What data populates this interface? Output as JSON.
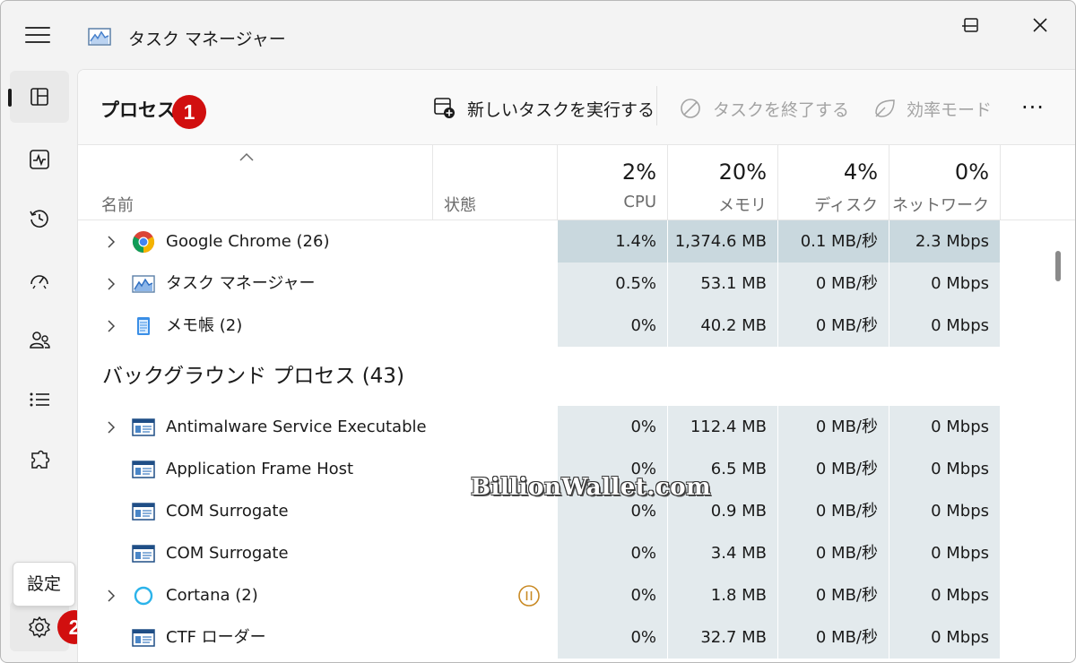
{
  "app": {
    "title": "タスク マネージャー"
  },
  "toolbar": {
    "page_title": "プロセス",
    "new_task_label": "新しいタスクを実行する",
    "end_task_label": "タスクを終了する",
    "efficiency_label": "効率モード",
    "more_label": "..."
  },
  "badges": {
    "one": "1",
    "two": "2"
  },
  "sidebar": {
    "tooltip_label": "設定"
  },
  "columns": {
    "name": "名前",
    "status": "状態",
    "cpu": {
      "pct": "2%",
      "label": "CPU"
    },
    "memory": {
      "pct": "20%",
      "label": "メモリ"
    },
    "disk": {
      "pct": "4%",
      "label": "ディスク"
    },
    "network": {
      "pct": "0%",
      "label": "ネットワーク"
    }
  },
  "apps_rows": [
    {
      "name": "Google Chrome (26)",
      "icon": "chrome-icon",
      "cpu": "1.4%",
      "memory": "1,374.6 MB",
      "disk": "0.1 MB/秒",
      "network": "2.3 Mbps"
    },
    {
      "name": "タスク マネージャー",
      "icon": "task-manager-icon",
      "cpu": "0.5%",
      "memory": "53.1 MB",
      "disk": "0 MB/秒",
      "network": "0 Mbps"
    },
    {
      "name": "メモ帳 (2)",
      "icon": "notepad-icon",
      "cpu": "0%",
      "memory": "40.2 MB",
      "disk": "0 MB/秒",
      "network": "0 Mbps"
    }
  ],
  "background_group": {
    "title": "バックグラウンド プロセス (43)"
  },
  "background_rows": [
    {
      "name": "Antimalware Service Executable",
      "icon": "window-icon",
      "cpu": "0%",
      "memory": "112.4 MB",
      "disk": "0 MB/秒",
      "network": "0 Mbps"
    },
    {
      "name": "Application Frame Host",
      "icon": "window-icon",
      "cpu": "0%",
      "memory": "6.5 MB",
      "disk": "0 MB/秒",
      "network": "0 Mbps"
    },
    {
      "name": "COM Surrogate",
      "icon": "window-icon",
      "cpu": "0%",
      "memory": "0.9 MB",
      "disk": "0 MB/秒",
      "network": "0 Mbps"
    },
    {
      "name": "COM Surrogate",
      "icon": "window-icon",
      "cpu": "0%",
      "memory": "3.4 MB",
      "disk": "0 MB/秒",
      "network": "0 Mbps"
    },
    {
      "name": "Cortana (2)",
      "icon": "cortana-icon",
      "cpu": "0%",
      "memory": "1.8 MB",
      "disk": "0 MB/秒",
      "network": "0 Mbps"
    },
    {
      "name": "CTF ローダー",
      "icon": "window-icon",
      "cpu": "0%",
      "memory": "32.7 MB",
      "disk": "0 MB/秒",
      "network": "0 Mbps"
    }
  ],
  "watermark": "BillionWallet.com",
  "colors": {
    "accent_badge": "#d10f0f",
    "data_cell": "#e3eaed",
    "data_cell_hot": "#c9d8de",
    "suspended": "#c98a24"
  }
}
